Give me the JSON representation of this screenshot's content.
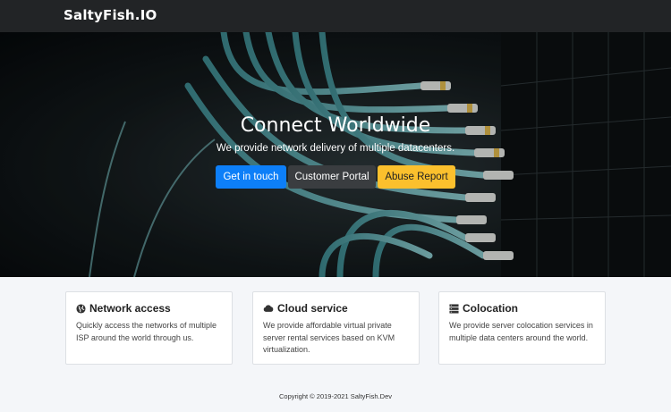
{
  "navbar": {
    "brand": "SaltyFish.IO"
  },
  "hero": {
    "title": "Connect Worldwide",
    "subtitle": "We provide network delivery of multiple datacenters.",
    "buttons": {
      "contact": "Get in touch",
      "portal": "Customer Portal",
      "abuse": "Abuse Report"
    }
  },
  "cards": [
    {
      "title": "Network access",
      "icon": "globe-icon",
      "text": "Quickly access the networks of multiple ISP around the world through us."
    },
    {
      "title": "Cloud service",
      "icon": "cloud-icon",
      "text": "We provide affordable virtual private server rental services based on KVM virtualization."
    },
    {
      "title": "Colocation",
      "icon": "server-icon",
      "text": "We provide server colocation services in multiple data centers around the world."
    }
  ],
  "footer": {
    "copyright": "Copyright © 2019-2021 SaltyFish.Dev"
  },
  "colors": {
    "primary": "#0d7ff8",
    "dark": "#3a3d40",
    "warning": "#fbc02d",
    "navbar": "#222426"
  }
}
